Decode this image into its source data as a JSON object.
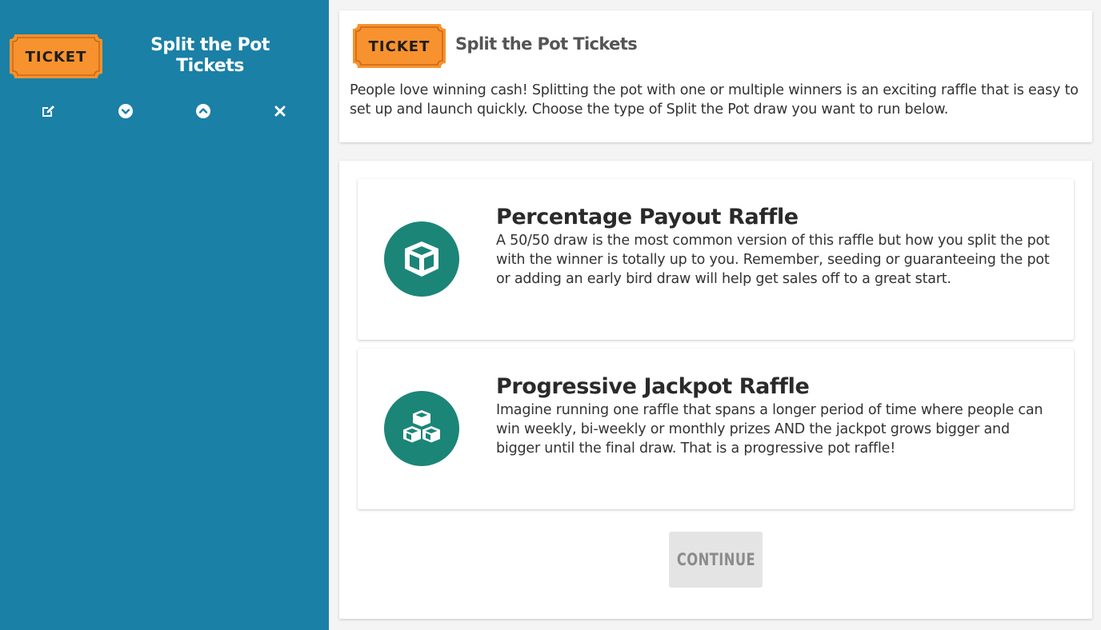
{
  "sidebar": {
    "ticket_label": "TICKET",
    "title": "Split the Pot Tickets",
    "actions": [
      {
        "name": "edit",
        "icon": "edit-icon"
      },
      {
        "name": "move-down",
        "icon": "chevron-circle-down-icon"
      },
      {
        "name": "move-up",
        "icon": "chevron-circle-up-icon"
      },
      {
        "name": "remove",
        "icon": "close-icon"
      }
    ]
  },
  "intro": {
    "ticket_label": "TICKET",
    "title": "Split the Pot Tickets",
    "description": "People love winning cash! Splitting the pot with one or multiple winners is an exciting raffle that is easy to set up and launch quickly. Choose the type of Split the Pot draw you want to run below."
  },
  "options": [
    {
      "title": "Percentage Payout Raffle",
      "description": "A 50/50 draw is the most common version of this raffle but how you split the pot with the winner is totally up to you. Remember, seeding or guaranteeing the pot or adding an early bird draw will help get sales off to a great start.",
      "icon": "cube-icon"
    },
    {
      "title": "Progressive Jackpot Raffle",
      "description": "Imagine running one raffle that spans a longer period of time where people can win weekly, bi-weekly or monthly prizes AND the jackpot grows bigger and bigger until the final draw. That is a progressive pot raffle!",
      "icon": "cubes-icon"
    }
  ],
  "continue_label": "CONTINUE",
  "colors": {
    "sidebar_bg": "#1a80a6",
    "ticket_orange": "#f7922e",
    "icon_teal": "#1b8578",
    "button_disabled_bg": "#e4e4e4"
  }
}
